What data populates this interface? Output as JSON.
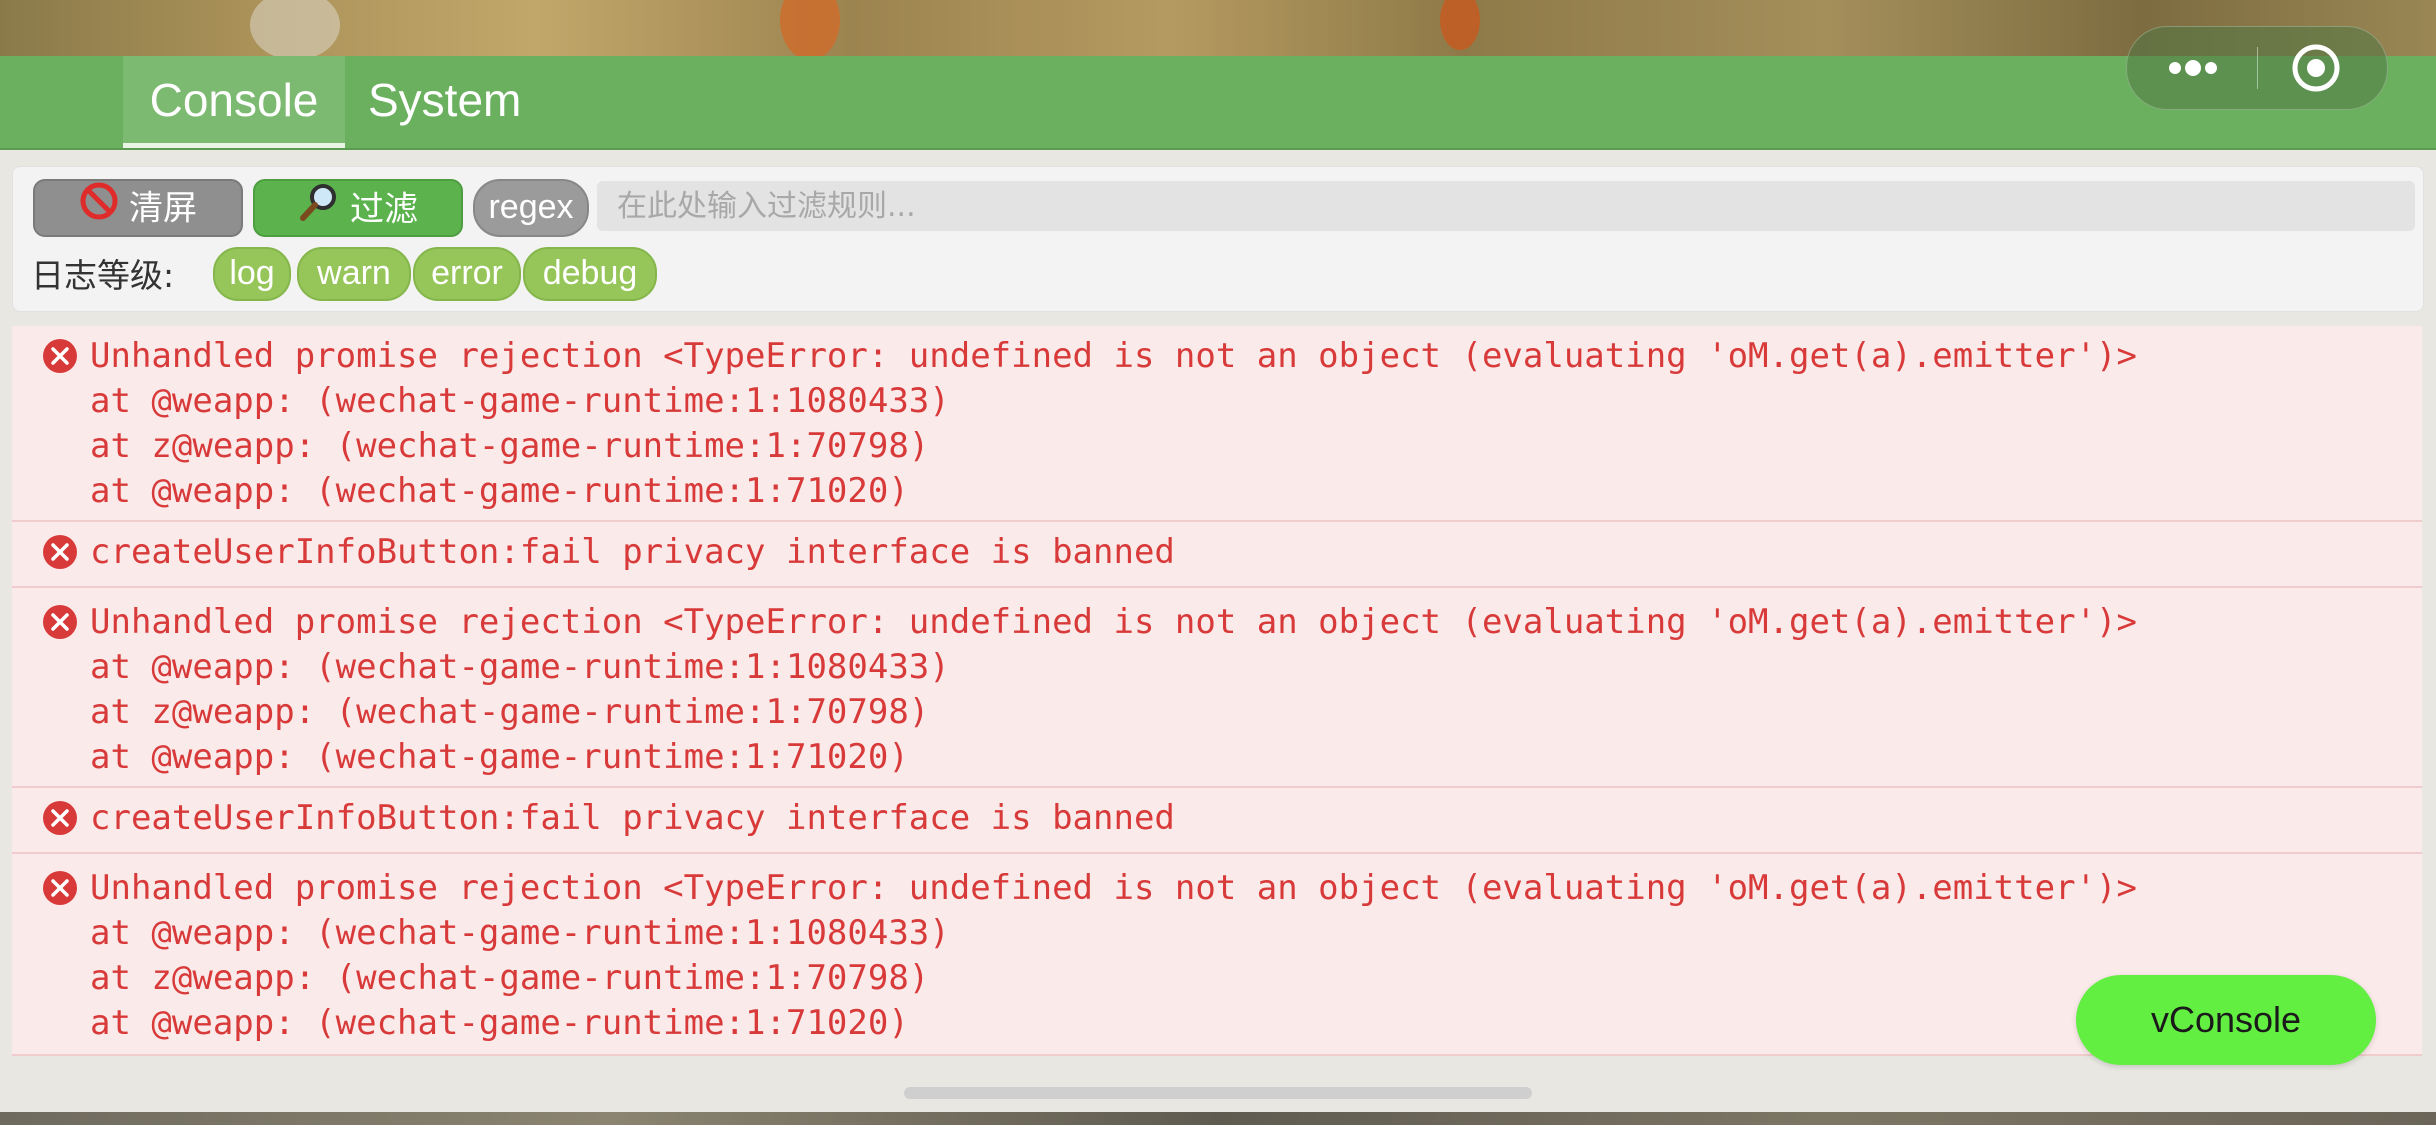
{
  "tabs": [
    {
      "label": "Console",
      "active": true
    },
    {
      "label": "System",
      "active": false
    }
  ],
  "capsule": {
    "more_icon": "more-dots-icon",
    "close_icon": "target-circle-icon"
  },
  "toolbar": {
    "clear_label": "清屏",
    "clear_icon": "no-entry-icon",
    "filter_label": "过滤",
    "filter_icon": "magnifier-icon",
    "regex_label": "regex",
    "filter_placeholder": "在此处输入过滤规则...",
    "filter_value": "",
    "level_label": "日志等级:",
    "levels": [
      "log",
      "warn",
      "error",
      "debug"
    ]
  },
  "logs": [
    {
      "type": "error",
      "text": "Unhandled promise rejection <TypeError: undefined is not an object (evaluating 'oM.get(a).emitter')>\nat @weapp: (wechat-game-runtime:1:1080433)\nat z@weapp: (wechat-game-runtime:1:70798)\nat @weapp: (wechat-game-runtime:1:71020)"
    },
    {
      "type": "error",
      "text": "createUserInfoButton:fail privacy interface is banned"
    },
    {
      "type": "error",
      "text": "Unhandled promise rejection <TypeError: undefined is not an object (evaluating 'oM.get(a).emitter')>\nat @weapp: (wechat-game-runtime:1:1080433)\nat z@weapp: (wechat-game-runtime:1:70798)\nat @weapp: (wechat-game-runtime:1:71020)"
    },
    {
      "type": "error",
      "text": "createUserInfoButton:fail privacy interface is banned"
    },
    {
      "type": "error",
      "text": "Unhandled promise rejection <TypeError: undefined is not an object (evaluating 'oM.get(a).emitter')>\nat @weapp: (wechat-game-runtime:1:1080433)\nat z@weapp: (wechat-game-runtime:1:70798)\nat @weapp: (wechat-game-runtime:1:71020)"
    }
  ],
  "vconsole_button": {
    "label": "vConsole"
  },
  "colors": {
    "header_green": "#6ab05e",
    "error_text": "#d83a3a",
    "error_bg": "#fbeaea",
    "vconsole_green": "#63ee42",
    "level_pill": "#96c65a"
  }
}
